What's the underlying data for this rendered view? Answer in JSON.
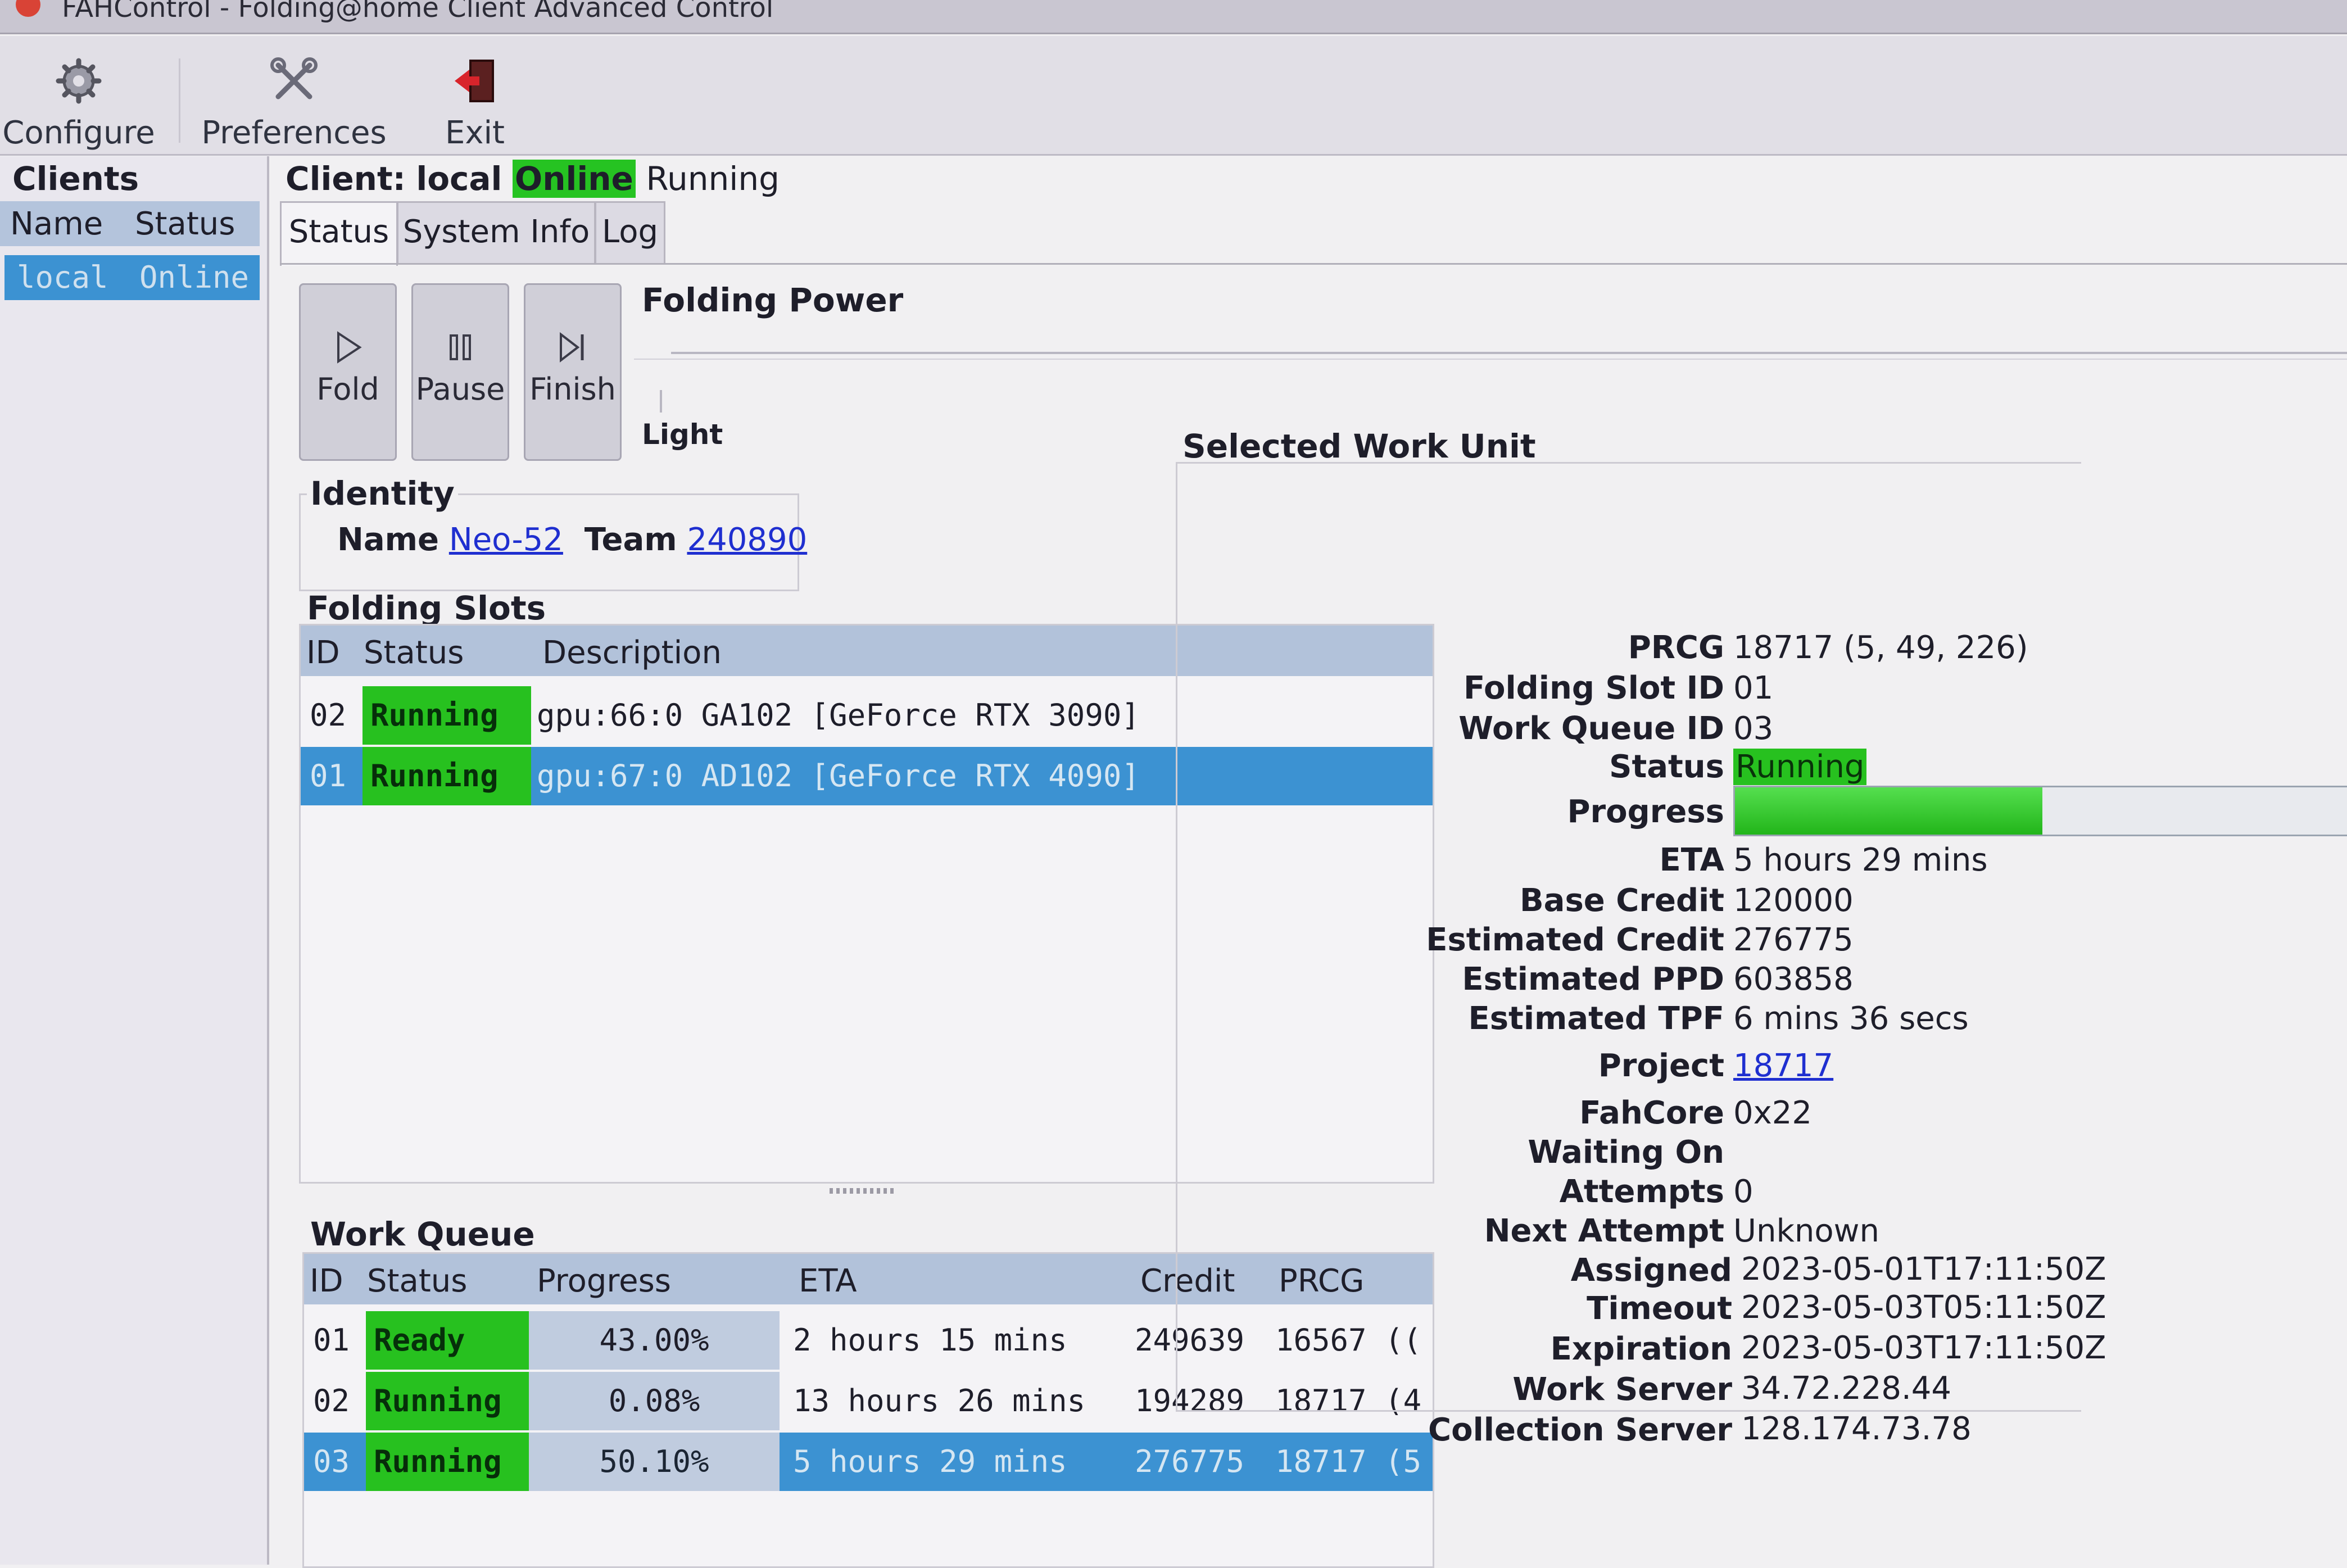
{
  "window": {
    "title": "FAHControl - Folding@home Client Advanced Control"
  },
  "toolbar": {
    "configure": "Configure",
    "preferences": "Preferences",
    "exit": "Exit"
  },
  "clients": {
    "title": "Clients",
    "headers": {
      "name": "Name",
      "status": "Status"
    },
    "rows": [
      {
        "name": "local",
        "status": "Online"
      }
    ]
  },
  "client_header": {
    "label": "Client:",
    "name": "local",
    "online": "Online",
    "state": "Running"
  },
  "tabs": {
    "status": "Status",
    "system_info": "System Info",
    "log": "Log"
  },
  "controls": {
    "fold": "Fold",
    "pause": "Pause",
    "finish": "Finish"
  },
  "folding_power": {
    "title": "Folding Power",
    "level": "Light"
  },
  "identity": {
    "title": "Identity",
    "name_label": "Name",
    "name": "Neo-52",
    "team_label": "Team",
    "team": "240890"
  },
  "slots": {
    "title": "Folding Slots",
    "headers": {
      "id": "ID",
      "status": "Status",
      "description": "Description"
    },
    "rows": [
      {
        "id": "02",
        "status": "Running",
        "description": "gpu:66:0 GA102 [GeForce RTX 3090]"
      },
      {
        "id": "01",
        "status": "Running",
        "description": "gpu:67:0 AD102 [GeForce RTX 4090]"
      }
    ]
  },
  "queue": {
    "title": "Work Queue",
    "headers": {
      "id": "ID",
      "status": "Status",
      "progress": "Progress",
      "eta": "ETA",
      "credit": "Credit",
      "prcg": "PRCG"
    },
    "rows": [
      {
        "id": "01",
        "status": "Ready",
        "progress": "43.00%",
        "eta": "2 hours 15 mins",
        "credit": "249639",
        "prcg": "16567 (("
      },
      {
        "id": "02",
        "status": "Running",
        "progress": "0.08%",
        "eta": "13 hours 26 mins",
        "credit": "194289",
        "prcg": "18717 (4"
      },
      {
        "id": "03",
        "status": "Running",
        "progress": "50.10%",
        "eta": "5 hours 29 mins",
        "credit": "276775",
        "prcg": "18717 (5"
      }
    ]
  },
  "work_unit": {
    "title": "Selected Work Unit",
    "labels": {
      "prcg": "PRCG",
      "slot": "Folding Slot ID",
      "queue": "Work Queue ID",
      "status": "Status",
      "progress": "Progress",
      "eta": "ETA",
      "base_credit": "Base Credit",
      "est_credit": "Estimated Credit",
      "est_ppd": "Estimated PPD",
      "est_tpf": "Estimated TPF",
      "project": "Project",
      "fahcore": "FahCore",
      "waiting": "Waiting On",
      "attempts": "Attempts",
      "next_attempt": "Next Attempt",
      "assigned": "Assigned",
      "timeout": "Timeout",
      "expiration": "Expiration",
      "work_server": "Work Server",
      "collection_server": "Collection Server"
    },
    "values": {
      "prcg": "18717 (5, 49, 226)",
      "slot": "01",
      "queue": "03",
      "status": "Running",
      "progress": 0.501,
      "eta": "5 hours 29 mins",
      "base_credit": "120000",
      "est_credit": "276775",
      "est_ppd": "603858",
      "est_tpf": "6 mins 36 secs",
      "project": "18717",
      "fahcore": "0x22",
      "waiting": "",
      "attempts": "0",
      "next_attempt": "Unknown",
      "assigned": "2023-05-01T17:11:50Z",
      "timeout": "2023-05-03T05:11:50Z",
      "expiration": "2023-05-03T17:11:50Z",
      "work_server": "34.72.228.44",
      "collection_server": "128.174.73.78"
    }
  },
  "colors": {
    "running": "#27c11f",
    "selected_row": "#3c92d2",
    "header_bg": "#b2c2da",
    "link": "#1f2fd0"
  }
}
